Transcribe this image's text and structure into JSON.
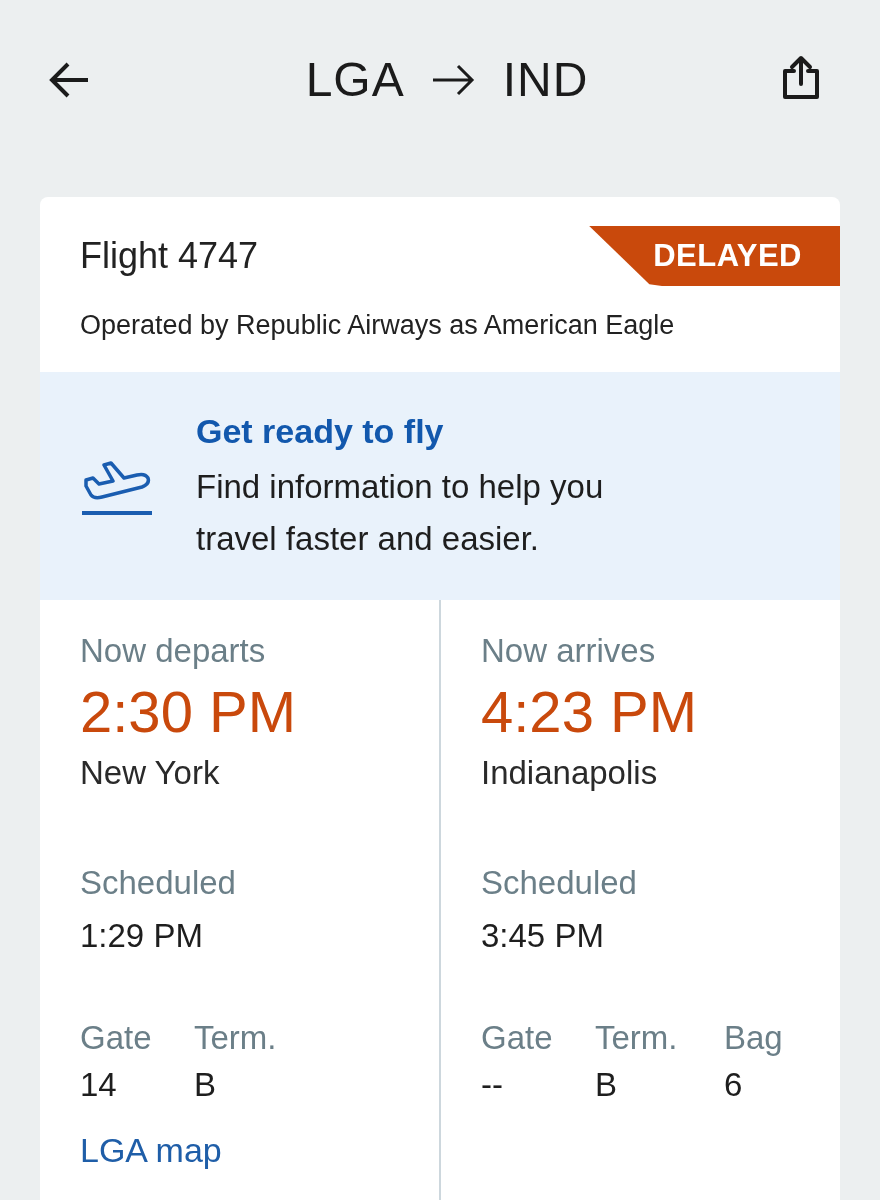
{
  "header": {
    "origin": "LGA",
    "destination": "IND"
  },
  "flight": {
    "title": "Flight 4747",
    "status": {
      "label": "DELAYED",
      "kind": "delayed"
    },
    "operator": "Operated by Republic Airways as American Eagle"
  },
  "promo": {
    "title": "Get ready to fly",
    "text": "Find information to help you travel faster and easier."
  },
  "legs": [
    {
      "label": "Now departs",
      "time": "2:30 PM",
      "city": "New York",
      "scheduled_label": "Scheduled",
      "scheduled_time": "1:29 PM",
      "details": [
        {
          "label": "Gate",
          "value": "14"
        },
        {
          "label": "Term.",
          "value": "B"
        }
      ],
      "link": "LGA map"
    },
    {
      "label": "Now arrives",
      "time": "4:23 PM",
      "city": "Indianapolis",
      "scheduled_label": "Scheduled",
      "scheduled_time": "3:45 PM",
      "details": [
        {
          "label": "Gate",
          "value": "--"
        },
        {
          "label": "Term.",
          "value": "B"
        },
        {
          "label": "Bag",
          "value": "6"
        }
      ]
    }
  ]
}
